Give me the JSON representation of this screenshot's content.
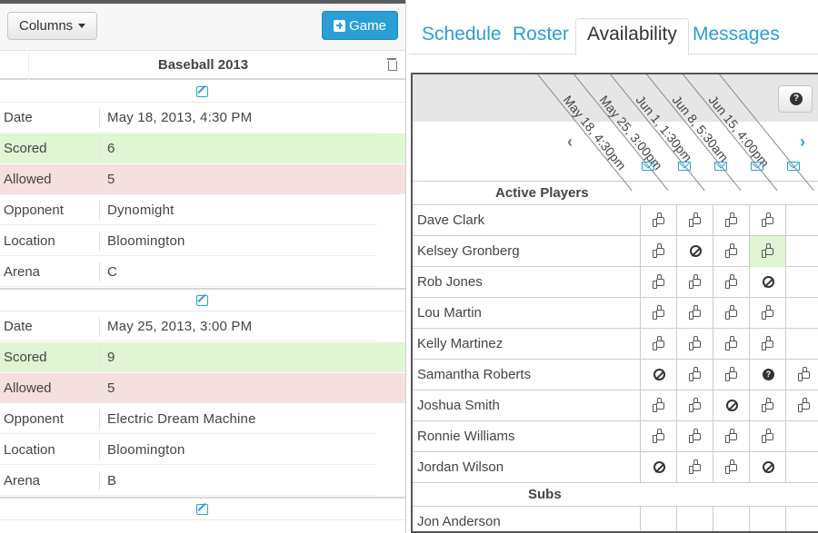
{
  "left": {
    "columns_label": "Columns",
    "game_label": "Game",
    "season_title": "Baseball 2013",
    "games": [
      {
        "date_label": "Date",
        "date": "May 18, 2013, 4:30 PM",
        "scored_label": "Scored",
        "scored": "6",
        "allowed_label": "Allowed",
        "allowed": "5",
        "opponent_label": "Opponent",
        "opponent": "Dynomight",
        "location_label": "Location",
        "location": "Bloomington",
        "arena_label": "Arena",
        "arena": "C"
      },
      {
        "date_label": "Date",
        "date": "May 25, 2013, 3:00 PM",
        "scored_label": "Scored",
        "scored": "9",
        "allowed_label": "Allowed",
        "allowed": "5",
        "opponent_label": "Opponent",
        "opponent": "Electric Dream Machine",
        "location_label": "Location",
        "location": "Bloomington",
        "arena_label": "Arena",
        "arena": "B"
      }
    ]
  },
  "tabs": [
    "Schedule",
    "Roster",
    "Availability",
    "Messages"
  ],
  "active_tab": "Availability",
  "availability": {
    "dates": [
      "May 18, 4:30pm",
      "May 25, 3:00pm",
      "Jun 1, 1:30pm",
      "Jun 8, 5:30am",
      "Jun 15, 4:00pm"
    ],
    "active_header": "Active Players",
    "subs_header": "Subs",
    "players": [
      {
        "name": "Dave Clark",
        "marks": [
          "yes",
          "yes",
          "yes",
          "yes",
          ""
        ]
      },
      {
        "name": "Kelsey Gronberg",
        "marks": [
          "yes",
          "no",
          "yes",
          "yes-hl",
          ""
        ]
      },
      {
        "name": "Rob Jones",
        "marks": [
          "yes",
          "yes",
          "yes",
          "no",
          ""
        ]
      },
      {
        "name": "Lou Martin",
        "marks": [
          "yes",
          "yes",
          "yes",
          "yes",
          ""
        ]
      },
      {
        "name": "Kelly Martinez",
        "marks": [
          "yes",
          "yes",
          "yes",
          "yes",
          ""
        ]
      },
      {
        "name": "Samantha Roberts",
        "marks": [
          "no",
          "yes",
          "yes",
          "maybe",
          "yes"
        ]
      },
      {
        "name": "Joshua Smith",
        "marks": [
          "yes",
          "yes",
          "no",
          "yes",
          "yes"
        ]
      },
      {
        "name": "Ronnie Williams",
        "marks": [
          "yes",
          "yes",
          "yes",
          "yes",
          ""
        ]
      },
      {
        "name": "Jordan Wilson",
        "marks": [
          "no",
          "yes",
          "yes",
          "no",
          ""
        ]
      }
    ],
    "subs": [
      {
        "name": "Jon Anderson",
        "marks": [
          "",
          "",
          "",
          "",
          ""
        ]
      }
    ]
  }
}
